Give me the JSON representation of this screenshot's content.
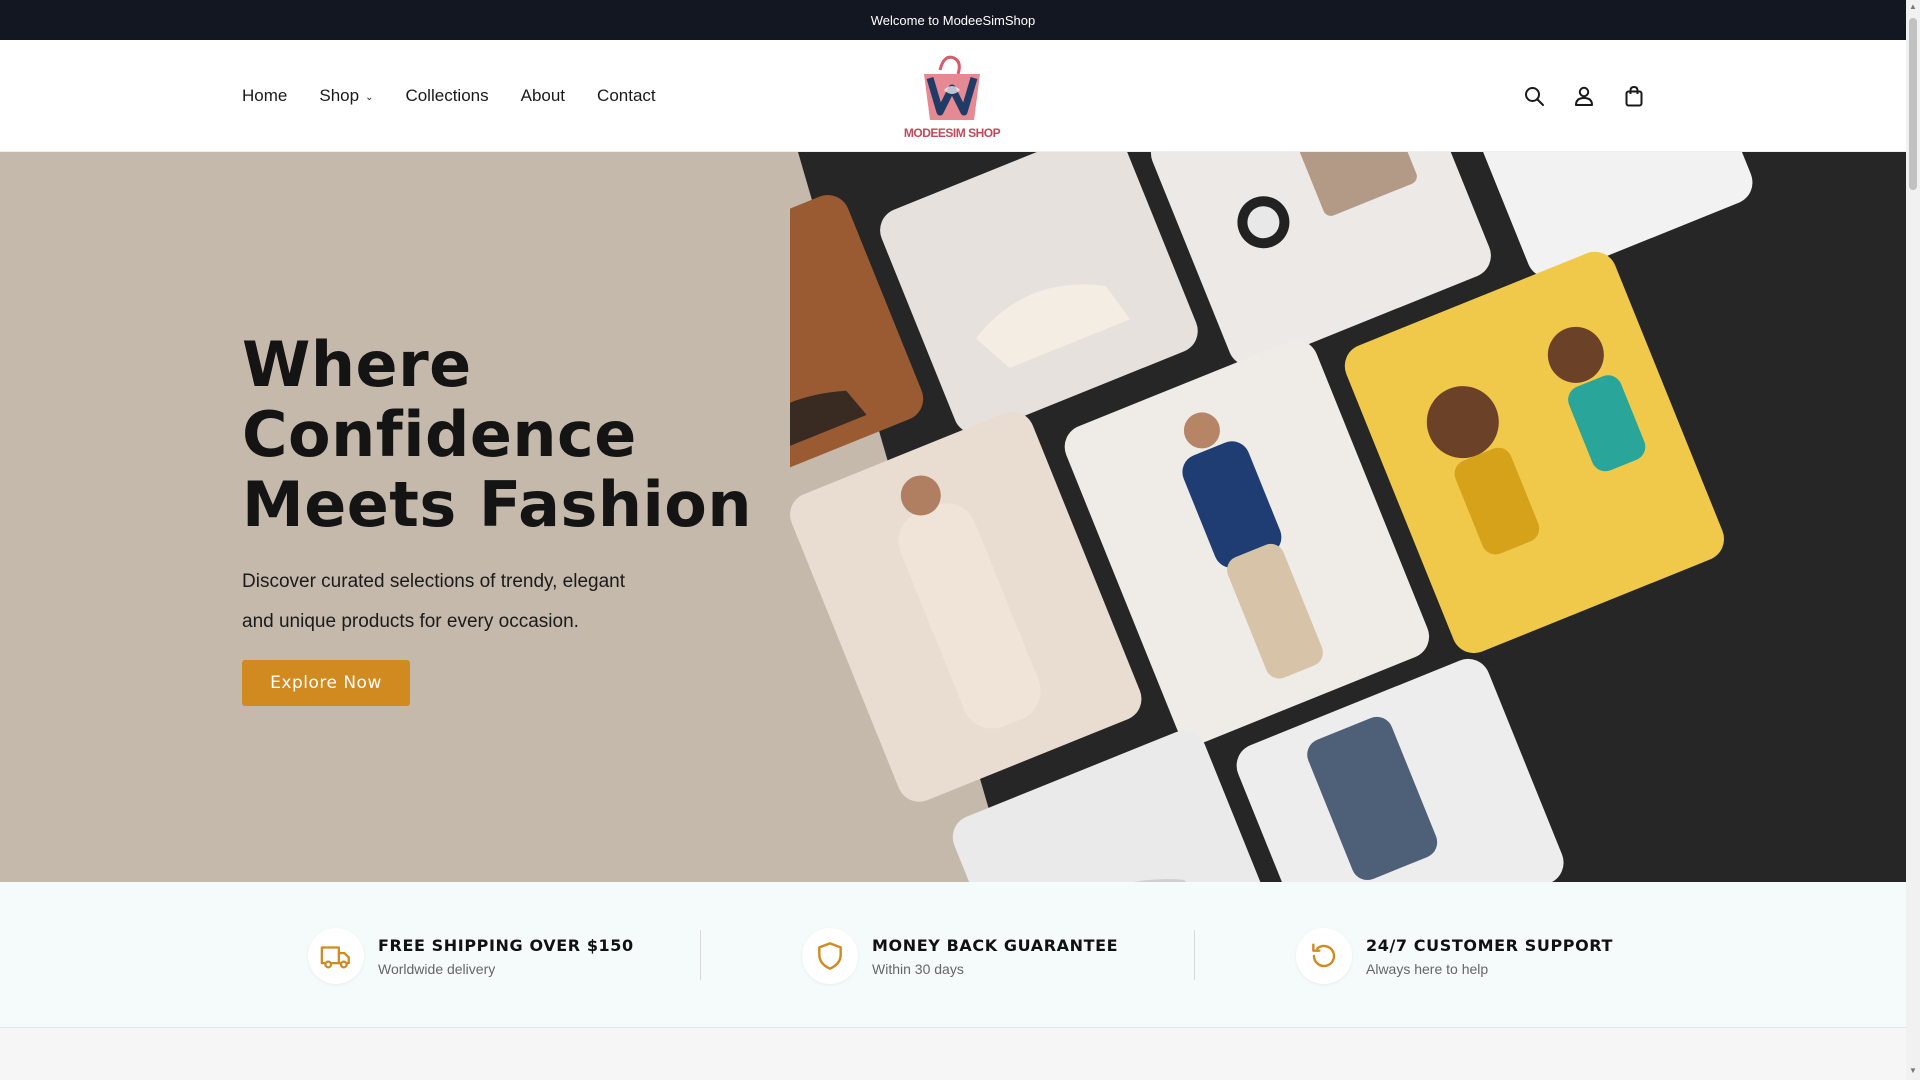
{
  "announcement": {
    "text": "Welcome to ModeeSimShop"
  },
  "nav": {
    "items": [
      {
        "label": "Home"
      },
      {
        "label": "Shop"
      },
      {
        "label": "Collections"
      },
      {
        "label": "About"
      },
      {
        "label": "Contact"
      }
    ]
  },
  "logo": {
    "text": "MODEESIM SHOP"
  },
  "hero": {
    "title_line1": "Where",
    "title_line2": "Confidence",
    "title_line3": "Meets Fashion",
    "subtitle_line1": "Discover curated selections of trendy, elegant",
    "subtitle_line2": "and unique products for every occasion.",
    "cta": "Explore Now"
  },
  "features": [
    {
      "title": "FREE SHIPPING OVER $150",
      "subtitle": "Worldwide delivery",
      "icon": "truck-icon"
    },
    {
      "title": "MONEY BACK GUARANTEE",
      "subtitle": "Within 30 days",
      "icon": "shield-icon"
    },
    {
      "title": "24/7 CUSTOMER SUPPORT",
      "subtitle": "Always here to help",
      "icon": "refresh-icon"
    }
  ],
  "colors": {
    "announcement_bg": "#131722",
    "hero_bg": "#c5b9ab",
    "accent": "#d18a1f",
    "features_bg": "#f4fbfa"
  }
}
